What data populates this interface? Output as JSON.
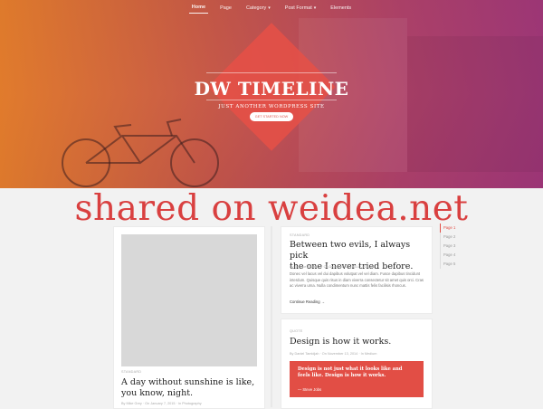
{
  "nav": {
    "items": [
      {
        "label": "Home",
        "active": true,
        "dropdown": false
      },
      {
        "label": "Page",
        "active": false,
        "dropdown": false
      },
      {
        "label": "Category",
        "active": false,
        "dropdown": true
      },
      {
        "label": "Post Format",
        "active": false,
        "dropdown": true
      },
      {
        "label": "Elements",
        "active": false,
        "dropdown": false
      }
    ]
  },
  "hero": {
    "title": "DW TIMELINE",
    "tagline": "JUST ANOTHER WORDPRESS SITE",
    "cta": "GET STARTED NOW"
  },
  "watermark": "shared on weidea.net",
  "posts": {
    "left": {
      "category": "STANDARD",
      "title_line1": "A day without sunshine is like,",
      "title_line2": "you know, night.",
      "meta": "By Mike Grey  ·  On January 7, 2015  ·  In Photography"
    },
    "right1": {
      "category": "STANDARD",
      "title_line1": "Between two evils, I always pick",
      "title_line2": "the one I never tried before.",
      "meta": "By Bernice Rachelle  ·  On December 26, 2014  ·  In Audio",
      "excerpt": "Donec vel lacus vel dui dapibus volutpat vel vel diam. Fusce dapibus tincidunt interdum. Quisque quis risus in diam viverra consectetur sit amet quis orci. Cras ac viverra urna. Nulla condimentum nunc mattis felis facilisis rhoncus.",
      "continue": "Continue Reading →"
    },
    "right2": {
      "category": "QUOTE",
      "title": "Design is how it works.",
      "meta": "By Daniel Tamidjah  ·  On November 13, 2014  ·  In Medium",
      "quote": "Design is not just what it looks like and feels like. Design is how it works.",
      "author": "— Steve Jobs"
    }
  },
  "pager": [
    "Page 1",
    "Page 2",
    "Page 3",
    "Page 4",
    "Page 5"
  ],
  "colors": {
    "accent": "#e24e45",
    "hero_orange": "#e87e2a",
    "hero_purple": "#a0347a"
  }
}
